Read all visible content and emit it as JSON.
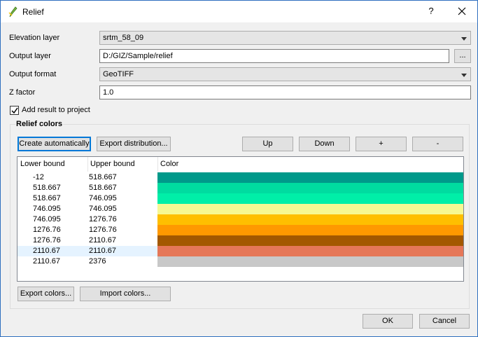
{
  "window": {
    "title": "Relief",
    "help_label": "?",
    "close_label": "✕"
  },
  "form": {
    "elevation_layer": {
      "label": "Elevation layer",
      "value": "srtm_58_09"
    },
    "output_layer": {
      "label": "Output layer",
      "value": "D:/GIZ/Sample/relief",
      "browse_label": "..."
    },
    "output_format": {
      "label": "Output format",
      "value": "GeoTIFF"
    },
    "z_factor": {
      "label": "Z factor",
      "value": "1.0"
    },
    "add_result": {
      "label": "Add result to project",
      "checked": true
    }
  },
  "relief": {
    "title": "Relief colors",
    "buttons": {
      "create": "Create automatically",
      "export_dist": "Export distribution...",
      "up": "Up",
      "down": "Down",
      "add": "+",
      "remove": "-"
    },
    "columns": [
      "Lower bound",
      "Upper bound",
      "Color"
    ],
    "rows": [
      {
        "lower": "-12",
        "upper": "518.667",
        "color": "#00998a"
      },
      {
        "lower": "518.667",
        "upper": "518.667",
        "color": "#00dca0"
      },
      {
        "lower": "518.667",
        "upper": "746.095",
        "color": "#00efa8"
      },
      {
        "lower": "746.095",
        "upper": "746.095",
        "color": "#f6f893"
      },
      {
        "lower": "746.095",
        "upper": "1276.76",
        "color": "#ffbf00"
      },
      {
        "lower": "1276.76",
        "upper": "1276.76",
        "color": "#ff9900"
      },
      {
        "lower": "1276.76",
        "upper": "2110.67",
        "color": "#a35800"
      },
      {
        "lower": "2110.67",
        "upper": "2110.67",
        "color": "#e57758"
      },
      {
        "lower": "2110.67",
        "upper": "2376",
        "color": "#c8c8c8"
      }
    ],
    "selected_row": 7,
    "export_colors": "Export colors...",
    "import_colors": "Import colors..."
  },
  "footer": {
    "ok": "OK",
    "cancel": "Cancel"
  },
  "colors": {
    "accent": "#0078d7",
    "selection": "#e5f3ff"
  }
}
